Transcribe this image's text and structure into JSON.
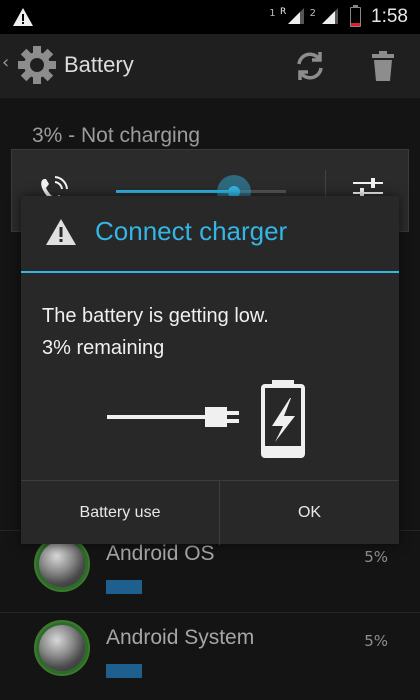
{
  "status_bar": {
    "sim1": "1",
    "sim1_roaming": "R",
    "sim2": "2",
    "time": "1:58",
    "icons": [
      "warning-icon",
      "signal-icon",
      "signal-icon",
      "battery-low-icon"
    ]
  },
  "action_bar": {
    "title": "Battery",
    "icons": [
      "gear-icon",
      "refresh-icon",
      "trash-icon"
    ]
  },
  "background": {
    "battery_status": "3% - Not charging",
    "apps": [
      {
        "name": "Android OS",
        "percent": "5%"
      },
      {
        "name": "Android System",
        "percent": "5%"
      }
    ]
  },
  "volume_panel": {
    "stream": "call",
    "level": 0.75,
    "accent": "#33b5e5"
  },
  "dialog": {
    "title": "Connect charger",
    "message_line1": "The battery is getting low.",
    "message_line2": "3% remaining",
    "buttons": {
      "left": "Battery use",
      "right": "OK"
    },
    "accent": "#33b5e5"
  }
}
